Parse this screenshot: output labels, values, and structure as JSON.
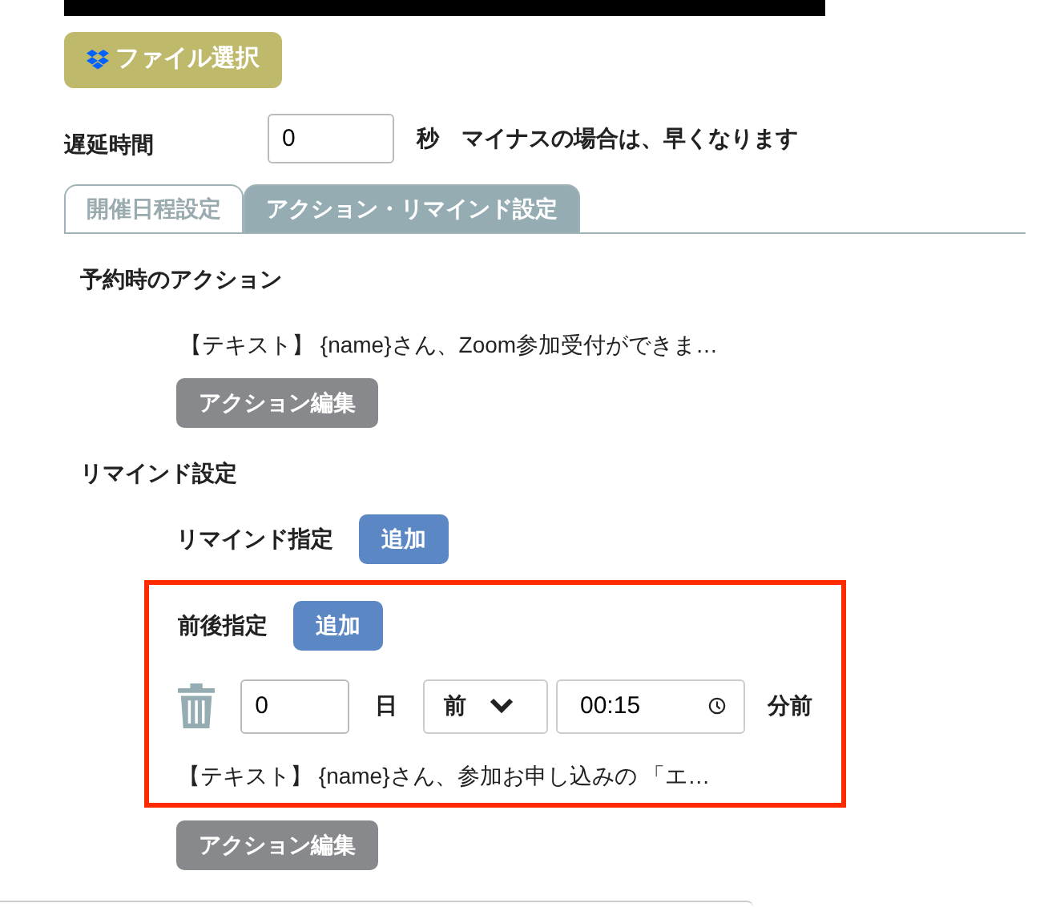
{
  "file_button": {
    "label": "ファイル選択"
  },
  "delay": {
    "label": "遅延時間",
    "value": "0",
    "unit": "秒",
    "note": "マイナスの場合は、早くなります"
  },
  "tabs": [
    {
      "label": "開催日程設定",
      "selected": false
    },
    {
      "label": "アクション・リマインド設定",
      "selected": true
    }
  ],
  "booking_action": {
    "heading": "予約時のアクション",
    "summary": "【テキスト】 {name}さん、Zoom参加受付ができま…",
    "button": "アクション編集"
  },
  "remind": {
    "heading": "リマインド設定",
    "remind_label": "リマインド指定",
    "remind_button": "追加",
    "relative": {
      "highlighted": true,
      "label": "前後指定",
      "button": "追加",
      "entries": [
        {
          "days": "0",
          "day_unit": "日",
          "direction": "前",
          "time": "00:15",
          "suffix": "分前",
          "summary": "【テキスト】 {name}さん、参加お申し込みの 「エ…",
          "button": "アクション編集"
        }
      ]
    }
  }
}
